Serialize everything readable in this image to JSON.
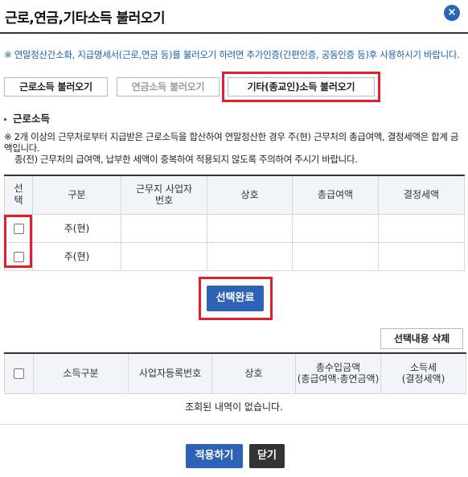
{
  "window": {
    "title": "근로,연금,기타소득 불러오기",
    "close_symbol": "×"
  },
  "notice": "※ 연말정산간소화, 지급명세서(근로,연금 등)를 불러오기 하려면 추가인증(간편인증, 공동인증 등)후 사용하시기 바랍니다.",
  "load_buttons": {
    "earned": "근로소득 불러오기",
    "pension": "연금소득 불러오기",
    "other": "기타(종교인)소득 불러오기"
  },
  "section": {
    "title": "근로소득",
    "desc_line1": "※ 2개 이상의 근무처로부터 지급받은 근로소득을 합산하여 연말정산한 경우 주(현) 근무처의 총급여액, 결정세액은 합계 금액입니다.",
    "desc_line2": "종(전) 근무처의 급여액, 납부한 세액이 중복하여 적용되지 않도록 주의하여 주시기 바랍니다."
  },
  "earned_table": {
    "headers": [
      "선택",
      "구분",
      "근무지 사업자번호",
      "상호",
      "총급여액",
      "결정세액"
    ],
    "rows": [
      {
        "type": "주(현)",
        "biz_no": "",
        "name": "",
        "total": "",
        "tax": ""
      },
      {
        "type": "주(현)",
        "biz_no": "",
        "name": "",
        "total": "",
        "tax": ""
      }
    ]
  },
  "select_done": "선택완료",
  "delete_selected": "선택내용 삭제",
  "income_table": {
    "headers": [
      "소득구분",
      "사업자등록번호",
      "상호",
      "총수입금액",
      "(총급여액·총연금액)",
      "소득세",
      "(결정세액)"
    ],
    "empty_text": "조회된 내역이 없습니다."
  },
  "footer": {
    "apply": "적용하기",
    "close": "닫기"
  },
  "colors": {
    "accent": "#2d63b6",
    "highlight": "#e0202b",
    "notice_text": "#1f5fa8"
  }
}
